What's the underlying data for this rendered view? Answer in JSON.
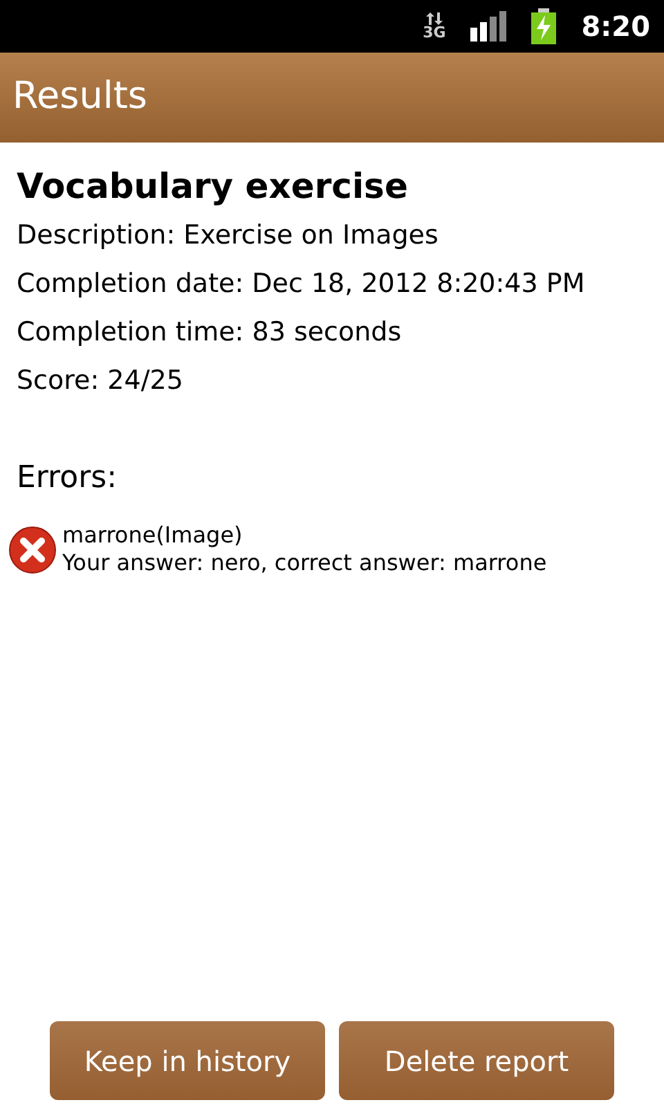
{
  "status_bar": {
    "network": "3G",
    "time": "8:20"
  },
  "app_bar": {
    "title": "Results"
  },
  "report": {
    "title": "Vocabulary exercise",
    "details": [
      "Description: Exercise on Images",
      "Completion date: Dec 18, 2012 8:20:43 PM",
      "Completion time: 83 seconds",
      "Score: 24/25"
    ]
  },
  "errors": {
    "heading": "Errors:",
    "items": [
      {
        "word": "marrone(Image)",
        "answer": "Your answer: nero, correct answer: marrone"
      }
    ]
  },
  "buttons": [
    "Keep in history",
    "Delete report"
  ]
}
